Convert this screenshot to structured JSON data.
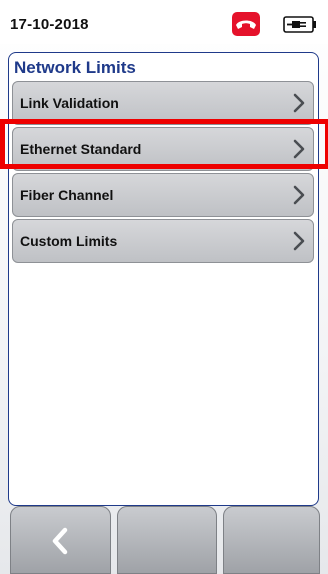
{
  "status_bar": {
    "date": "17-10-2018",
    "call_icon": "hang-up-phone-icon",
    "call_icon_color": "#e5122b",
    "power_icon": "ac-power-plug-icon"
  },
  "panel": {
    "title": "Network Limits",
    "title_color": "#1f3a8a",
    "items": [
      {
        "label": "Link Validation",
        "icon": "chevron-right-icon"
      },
      {
        "label": "Ethernet Standard",
        "icon": "chevron-right-icon",
        "highlighted": true
      },
      {
        "label": "Fiber Channel",
        "icon": "chevron-right-icon"
      },
      {
        "label": "Custom Limits",
        "icon": "chevron-right-icon"
      }
    ]
  },
  "softkeys": [
    {
      "icon": "chevron-left-icon",
      "label": ""
    },
    {
      "icon": "",
      "label": ""
    },
    {
      "icon": "",
      "label": ""
    }
  ],
  "highlight_color": "#ee0000"
}
